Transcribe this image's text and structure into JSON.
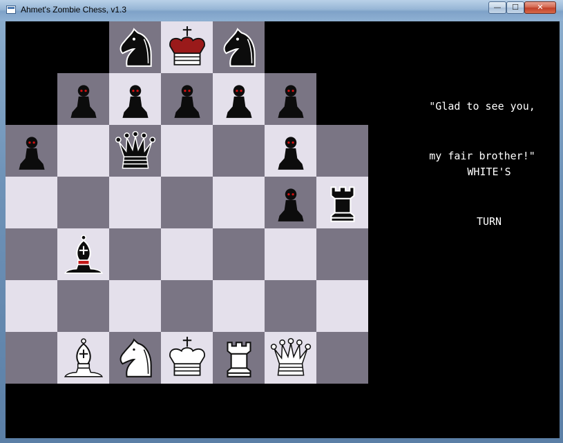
{
  "window": {
    "title": "Ahmet's Zombie Chess, v1.3",
    "minimize_label": "—",
    "maximize_label": "☐",
    "close_label": "✕"
  },
  "colors": {
    "light_square": "#e4e0eb",
    "dark_square": "#7a7584",
    "void": "#000000",
    "zombie_eye": "#d01010",
    "king_crown_red": "#9a1a1a"
  },
  "speech": {
    "line1": "\"Glad to see you,",
    "line2": "my fair brother!\""
  },
  "status": {
    "line1": "WHITE'S",
    "line2": "TURN"
  },
  "board": {
    "rows": [
      [
        "void",
        "void",
        "dark",
        "light",
        "dark",
        "void",
        "void"
      ],
      [
        "void",
        "dark",
        "light",
        "dark",
        "light",
        "dark",
        "void"
      ],
      [
        "dark",
        "light",
        "dark",
        "light",
        "dark",
        "light",
        "dark"
      ],
      [
        "light",
        "dark",
        "light",
        "dark",
        "light",
        "dark",
        "light"
      ],
      [
        "dark",
        "light",
        "dark",
        "light",
        "dark",
        "light",
        "dark"
      ],
      [
        "light",
        "dark",
        "light",
        "dark",
        "light",
        "dark",
        "light"
      ],
      [
        "dark",
        "light",
        "dark",
        "light",
        "dark",
        "light",
        "dark"
      ]
    ],
    "pieces": [
      {
        "row": 0,
        "col": 2,
        "piece": "knight",
        "color": "black"
      },
      {
        "row": 0,
        "col": 3,
        "piece": "king",
        "color": "black"
      },
      {
        "row": 0,
        "col": 4,
        "piece": "knight",
        "color": "black"
      },
      {
        "row": 1,
        "col": 1,
        "piece": "pawn",
        "color": "black"
      },
      {
        "row": 1,
        "col": 2,
        "piece": "pawn",
        "color": "black"
      },
      {
        "row": 1,
        "col": 3,
        "piece": "pawn",
        "color": "black"
      },
      {
        "row": 1,
        "col": 4,
        "piece": "pawn",
        "color": "black"
      },
      {
        "row": 1,
        "col": 5,
        "piece": "pawn",
        "color": "black"
      },
      {
        "row": 2,
        "col": 0,
        "piece": "pawn",
        "color": "black"
      },
      {
        "row": 2,
        "col": 2,
        "piece": "queen",
        "color": "black"
      },
      {
        "row": 2,
        "col": 5,
        "piece": "pawn",
        "color": "black"
      },
      {
        "row": 3,
        "col": 5,
        "piece": "pawn",
        "color": "black"
      },
      {
        "row": 3,
        "col": 6,
        "piece": "rook",
        "color": "black"
      },
      {
        "row": 4,
        "col": 1,
        "piece": "bishop",
        "color": "black"
      },
      {
        "row": 6,
        "col": 1,
        "piece": "bishop",
        "color": "white"
      },
      {
        "row": 6,
        "col": 2,
        "piece": "knight",
        "color": "white"
      },
      {
        "row": 6,
        "col": 3,
        "piece": "king",
        "color": "white"
      },
      {
        "row": 6,
        "col": 4,
        "piece": "rook",
        "color": "white"
      },
      {
        "row": 6,
        "col": 5,
        "piece": "queen",
        "color": "white"
      }
    ]
  }
}
